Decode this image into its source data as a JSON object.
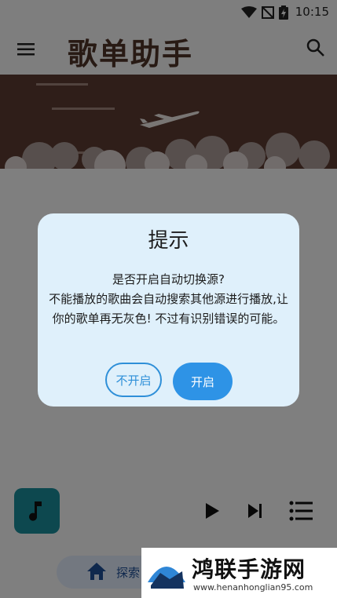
{
  "status_bar": {
    "time": "10:15"
  },
  "app_bar": {
    "title": "歌单助手"
  },
  "bottom_nav": {
    "explore_label": "探索"
  },
  "dialog": {
    "title": "提示",
    "message_line1": "是否开启自动切换源?",
    "message_line2": "不能播放的歌曲会自动搜索其他源进行播放,让你的歌单再无灰色! 不过有识别错误的可能。",
    "cancel_label": "不开启",
    "confirm_label": "开启"
  },
  "watermark": {
    "text": "鸿联手游网",
    "url": "www.henanhonglian95.com"
  },
  "colors": {
    "accent": "#2e93e6",
    "banner": "#5b3a30",
    "title": "#4e3328",
    "album": "#1a8b97"
  }
}
